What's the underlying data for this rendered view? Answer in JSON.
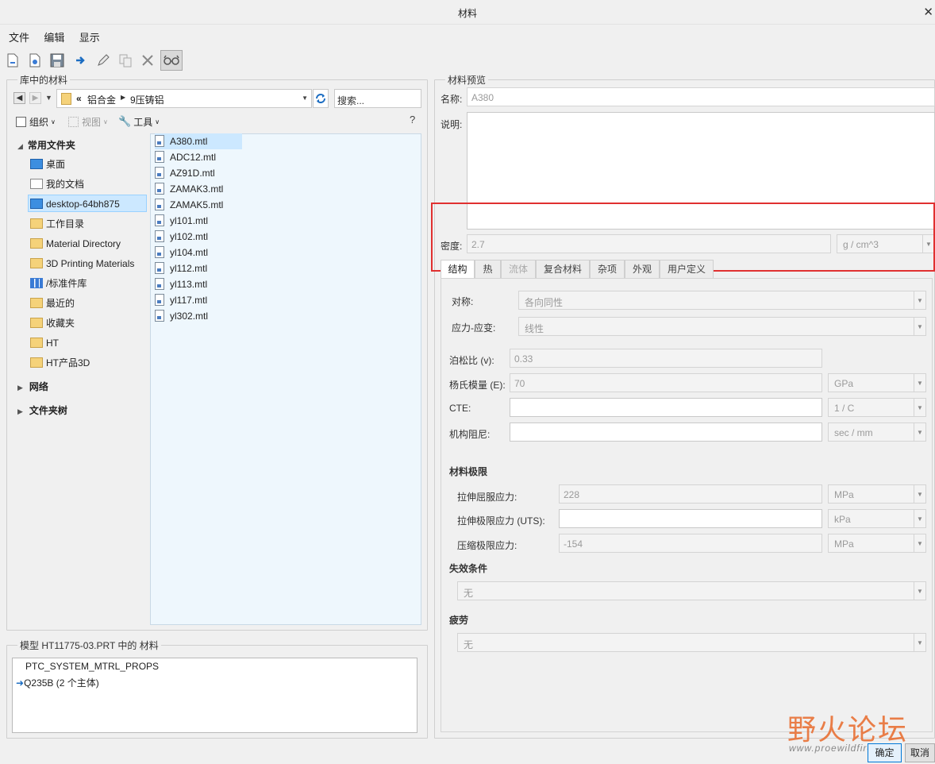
{
  "window": {
    "title": "材料"
  },
  "menu": [
    "文件",
    "编辑",
    "显示"
  ],
  "toolbar": {
    "icons": [
      "new-file-icon",
      "open-file-icon",
      "save-icon",
      "import-arrow-icon",
      "edit-pencil-icon",
      "copy-icon",
      "delete-x-icon",
      "glasses-icon"
    ]
  },
  "library": {
    "group_label": "库中的材料",
    "breadcrumb": {
      "prefix": "«",
      "parts": [
        "铝合金",
        "9压铸铝"
      ]
    },
    "search_placeholder": "搜索...",
    "organize_label": "组织",
    "view_label": "视图",
    "tools_label": "工具",
    "help_label": "?",
    "tree": {
      "favorites_label": "常用文件夹",
      "items": [
        {
          "label": "桌面",
          "icon": "monitor-icon"
        },
        {
          "label": "我的文档",
          "icon": "documents-icon"
        },
        {
          "label": "desktop-64bh875",
          "icon": "computer-icon",
          "selected": true
        },
        {
          "label": "工作目录",
          "icon": "folder-star-icon"
        },
        {
          "label": "Material Directory",
          "icon": "folder-icon"
        },
        {
          "label": "3D Printing Materials",
          "icon": "folder-icon"
        },
        {
          "label": "/标准件库",
          "icon": "library-icon"
        },
        {
          "label": "最近的",
          "icon": "recent-icon"
        },
        {
          "label": "收藏夹",
          "icon": "favorites-icon"
        },
        {
          "label": "HT",
          "icon": "folder-icon"
        },
        {
          "label": "HT产品3D",
          "icon": "folder-icon"
        }
      ],
      "network_label": "网络",
      "filetree_label": "文件夹树"
    },
    "files": [
      "A380.mtl",
      "ADC12.mtl",
      "AZ91D.mtl",
      "ZAMAK3.mtl",
      "ZAMAK5.mtl",
      "yl101.mtl",
      "yl102.mtl",
      "yl104.mtl",
      "yl112.mtl",
      "yl113.mtl",
      "yl117.mtl",
      "yl302.mtl"
    ],
    "selected_file": "A380.mtl"
  },
  "model": {
    "group_label": "模型 HT11775-03.PRT 中的 材料",
    "items": [
      "PTC_SYSTEM_MTRL_PROPS",
      "Q235B (2 个主体)"
    ]
  },
  "preview": {
    "group_label": "材料预览",
    "name_label": "名称:",
    "name_value": "A380",
    "desc_label": "说明:",
    "density_label": "密度:",
    "density_value": "2.7",
    "density_unit": "g / cm^3",
    "tabs": [
      {
        "label": "结构",
        "active": true
      },
      {
        "label": "热"
      },
      {
        "label": "流体",
        "disabled": true
      },
      {
        "label": "复合材料"
      },
      {
        "label": "杂项"
      },
      {
        "label": "外观"
      },
      {
        "label": "用户定义"
      }
    ],
    "structure": {
      "symmetry_label": "对称:",
      "symmetry_value": "各向同性",
      "stress_strain_label": "应力-应变:",
      "stress_strain_value": "线性",
      "poisson_label": "泊松比 (v):",
      "poisson_value": "0.33",
      "young_label": "杨氏模量 (E):",
      "young_value": "70",
      "young_unit": "GPa",
      "cte_label": "CTE:",
      "cte_value": "",
      "cte_unit": "1 / C",
      "damping_label": "机构阻尼:",
      "damping_value": "",
      "damping_unit": "sec / mm",
      "limits_label": "材料极限",
      "tensile_yield_label": "拉伸屈服应力:",
      "tensile_yield_value": "228",
      "tensile_yield_unit": "MPa",
      "uts_label": "拉伸极限应力 (UTS):",
      "uts_value": "",
      "uts_unit": "kPa",
      "compressive_label": "压缩极限应力:",
      "compressive_value": "-154",
      "compressive_unit": "MPa",
      "failure_label": "失效条件",
      "failure_value": "无",
      "fatigue_label": "疲劳",
      "fatigue_value": "无"
    }
  },
  "buttons": {
    "ok": "确定",
    "cancel": "取消"
  },
  "watermark": {
    "text": "野火论坛",
    "url": "www.proewildfire.cn"
  },
  "colors": {
    "highlight_border": "#e03030",
    "selection": "#cce8ff"
  }
}
